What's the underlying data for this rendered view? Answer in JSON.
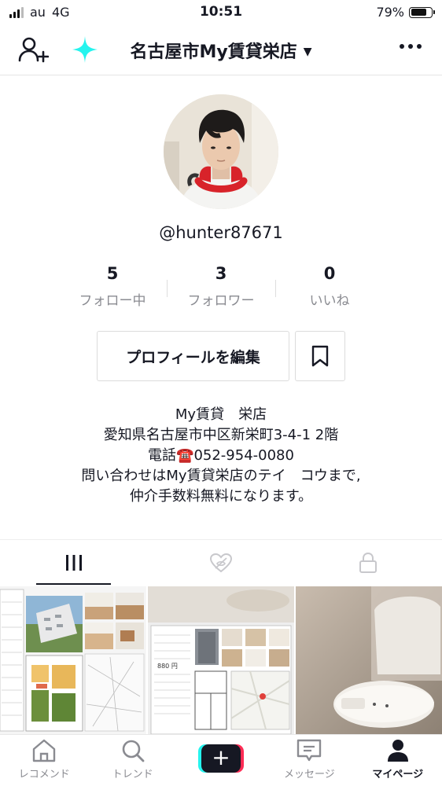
{
  "status_bar": {
    "carrier": "au",
    "network": "4G",
    "time": "10:51",
    "battery": "79%",
    "battery_level": 0.79
  },
  "header": {
    "title": "名古屋市My賃貸栄店",
    "caret": "▼"
  },
  "profile": {
    "username": "@hunter87671",
    "stats": [
      {
        "num": "5",
        "label": "フォロー中"
      },
      {
        "num": "3",
        "label": "フォロワー"
      },
      {
        "num": "0",
        "label": "いいね"
      }
    ],
    "edit_button": "プロフィールを編集",
    "bio": [
      "My賃貸　栄店",
      "愛知県名古屋市中区新栄町3-4-1 2階",
      "電話☎️052-954-0080",
      "問い合わせはMy賃貸栄店のテイ　コウまで,",
      "仲介手数料無料になります。"
    ]
  },
  "tabs": [
    "videos-grid",
    "liked",
    "private"
  ],
  "grid": {
    "cell2_price": "880 円"
  },
  "bottom_nav": [
    {
      "label": "レコメンド",
      "icon": "home-icon"
    },
    {
      "label": "トレンド",
      "icon": "search-icon"
    },
    {
      "label": "",
      "icon": "plus-icon"
    },
    {
      "label": "メッセージ",
      "icon": "message-icon"
    },
    {
      "label": "マイページ",
      "icon": "profile-icon"
    }
  ],
  "colors": {
    "accent_cyan": "#25f4ee",
    "accent_pink": "#fe2c55",
    "headphones_red": "#d8232a",
    "text_primary": "#161823",
    "text_secondary": "#8a8b91"
  }
}
